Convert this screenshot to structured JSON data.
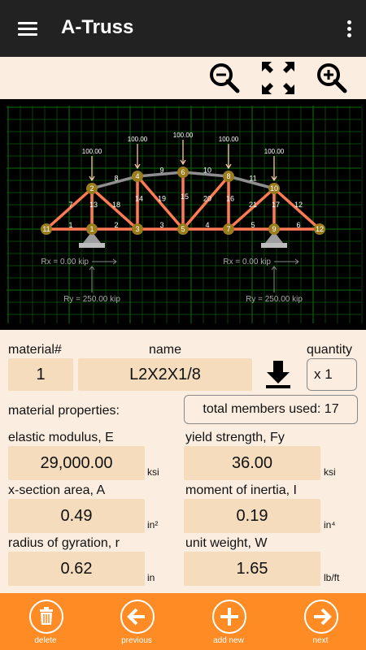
{
  "app": {
    "title": "A-Truss"
  },
  "toolbar": {
    "zoom_out_icon": "zoom-out-icon",
    "fit_icon": "fit-screen-icon",
    "zoom_in_icon": "zoom-in-icon"
  },
  "truss": {
    "loads": [
      "100.00",
      "100.00",
      "100.00",
      "100.00",
      "100.00"
    ],
    "nodes": [
      "1",
      "2",
      "3",
      "4",
      "5",
      "6",
      "7",
      "8",
      "9",
      "10",
      "11",
      "12"
    ],
    "members": [
      "1",
      "2",
      "3",
      "4",
      "5",
      "6",
      "7",
      "8",
      "9",
      "10",
      "11",
      "12",
      "13",
      "14",
      "15",
      "16",
      "17",
      "18",
      "19",
      "20",
      "21"
    ],
    "reactions": {
      "left_rx": "Rx = 0.00 kip",
      "right_rx": "Rx = 0.00 kip",
      "left_ry": "Ry = 250.00 kip",
      "right_ry": "Ry = 250.00 kip"
    },
    "colors": {
      "member": "#ff7a55",
      "top_chord_gray": "#8f8f8f",
      "node_fill": "#9c7d1e",
      "grid": "#0b5a0b",
      "load": "#f3c7a9"
    }
  },
  "material": {
    "number_label": "material#",
    "name_label": "name",
    "quantity_label": "quantity",
    "number": "1",
    "name": "L2X2X1/8",
    "quantity": "x 1",
    "properties_label": "material properties:",
    "total_members": "total members used: 17",
    "elastic_modulus_label": "elastic modulus, E",
    "elastic_modulus": "29,000.00",
    "elastic_modulus_unit": "ksi",
    "yield_strength_label": "yield strength, Fy",
    "yield_strength": "36.00",
    "yield_strength_unit": "ksi",
    "area_label": "x-section area, A",
    "area": "0.49",
    "area_unit": "in²",
    "inertia_label": "moment of inertia, I",
    "inertia": "0.19",
    "inertia_unit": "in⁴",
    "gyration_label": "radius of gyration, r",
    "gyration": "0.62",
    "gyration_unit": "in",
    "unit_weight_label": "unit weight, W",
    "unit_weight": "1.65",
    "unit_weight_unit": "lb/ft"
  },
  "bottom": {
    "delete": "delete",
    "previous": "previous",
    "add_new": "add new",
    "next": "next"
  }
}
